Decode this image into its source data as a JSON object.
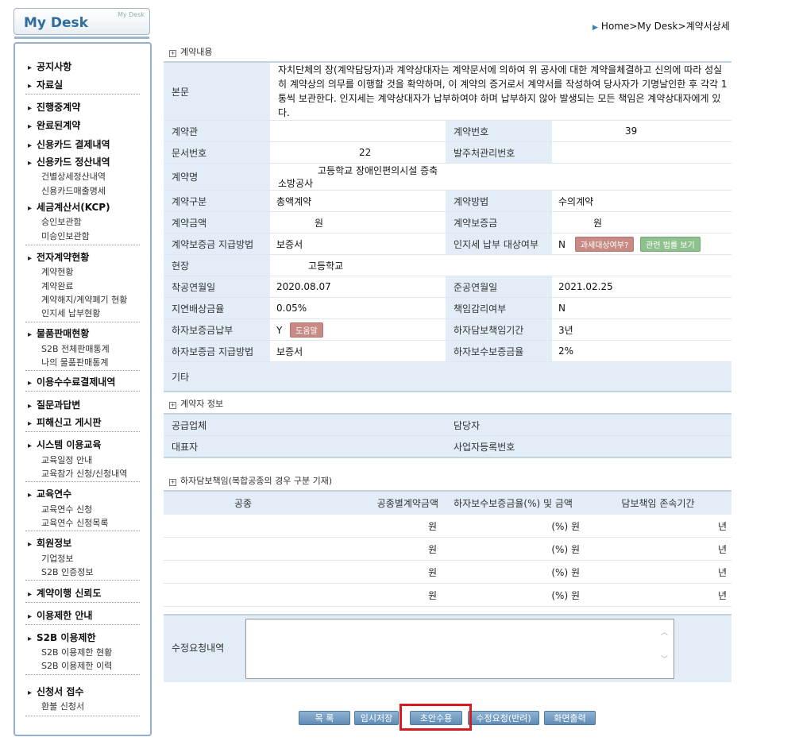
{
  "header": {
    "mydesk_title": "My Desk",
    "mydesk_small": "My Desk",
    "breadcrumb": "Home>My Desk>계약서상세"
  },
  "sidebar": {
    "sections": [
      {
        "items": [
          {
            "label": "공지사항"
          },
          {
            "label": "자료실"
          }
        ]
      },
      {
        "items": [
          {
            "label": "진행중계약"
          },
          {
            "label": "완료된계약"
          },
          {
            "label": "신용카드 결제내역"
          },
          {
            "label": "신용카드 정산내역"
          }
        ],
        "subs": [
          "건별상세정산내역",
          "신용카드매출명세"
        ]
      },
      {
        "items": [
          {
            "label": "세금계산서(KCP)"
          }
        ],
        "subs": [
          "승인보관함",
          "미승인보관함"
        ]
      },
      {
        "items": [
          {
            "label": "전자계약현황"
          }
        ],
        "subs": [
          "계약현황",
          "계약완료",
          "계약해지/계약폐기 현황",
          "인지세 납부현황"
        ]
      },
      {
        "items": [
          {
            "label": "물품판매현황"
          }
        ],
        "subs": [
          "S2B 전체판매통계",
          "나의 물품판매통계"
        ]
      },
      {
        "items": [
          {
            "label": "이용수수료결제내역"
          }
        ]
      },
      {
        "items": [
          {
            "label": "질문과답변"
          },
          {
            "label": "피해신고 게시판"
          }
        ]
      },
      {
        "items": [
          {
            "label": "시스템 이용교육"
          }
        ],
        "subs": [
          "교육일정 안내",
          "교육참가 신청/신청내역"
        ]
      },
      {
        "items": [
          {
            "label": "교육연수"
          }
        ],
        "subs": [
          "교육연수 신청",
          "교육연수 신청목록"
        ]
      },
      {
        "items": [
          {
            "label": "회원정보"
          }
        ],
        "subs": [
          "기업정보",
          "S2B 인증정보"
        ]
      },
      {
        "items": [
          {
            "label": "계약이행 신뢰도"
          }
        ]
      },
      {
        "items": [
          {
            "label": "이용제한 안내"
          }
        ]
      },
      {
        "items": [
          {
            "label": "S2B 이용제한"
          }
        ],
        "subs": [
          "S2B 이용제한 현황",
          "S2B 이용제한 이력"
        ]
      },
      {
        "items": [
          {
            "label": "신청서 접수"
          }
        ],
        "subs": [
          "환불 신청서"
        ]
      }
    ]
  },
  "contract": {
    "section_title": "계약내용",
    "body_label": "본문",
    "body_text": "자치단체의 장(계약담당자)과 계약상대자는 계약문서에 의하여 위 공사에 대한 계약을체결하고 신의에 따라 성실히 계약상의 의무를 이행할 것을 확약하며, 이 계약의 증거로서 계약서를 작성하여 당사자가 기명날인한 후 각각 1통씩 보관한다. 인지세는 계약상대자가 납부하여야 하며 납부하지 않아 발생되는 모든 책임은 계약상대자에게 있다.",
    "rows": [
      {
        "l1": "계약관",
        "v1": "",
        "l2": "계약번호",
        "v2": "39"
      },
      {
        "l1": "문서번호",
        "v1": "22",
        "l2": "발주처관리번호",
        "v2": ""
      },
      {
        "l1": "계약명",
        "v1": "고등학교 장애인편의시설 증축 소방공사",
        "l2": "",
        "v2": ""
      },
      {
        "l1": "계약구분",
        "v1": "총액계약",
        "l2": "계약방법",
        "v2": "수의계약"
      },
      {
        "l1": "계약금액",
        "v1": "원",
        "l2": "계약보증금",
        "v2": "원"
      },
      {
        "l1": "계약보증금 지급방법",
        "v1": "보증서",
        "l2": "인지세 납부 대상여부",
        "v2": "N"
      },
      {
        "l1": "현장",
        "v1": "고등학교",
        "l2": "",
        "v2": ""
      },
      {
        "l1": "착공연월일",
        "v1": "2020.08.07",
        "l2": "준공연월일",
        "v2": "2021.02.25"
      },
      {
        "l1": "지연배상금율",
        "v1": "0.05%",
        "l2": "책임감리여부",
        "v2": "N"
      },
      {
        "l1": "하자보증금납부",
        "v1": "Y",
        "l2": "하자담보책임기간",
        "v2": "3년"
      },
      {
        "l1": "하자보증금 지급방법",
        "v1": "보증서",
        "l2": "하자보수보증금율",
        "v2": "2%"
      }
    ],
    "etc_label": "기타",
    "tax_button": "과세대상여부?",
    "law_button": "관련 법률 보기",
    "help_button": "도움말"
  },
  "contractor": {
    "section_title": "계약자 정보",
    "rows": [
      {
        "l1": "공급업체",
        "l2": "담당자"
      },
      {
        "l1": "대표자",
        "l2": "사업자등록번호"
      }
    ]
  },
  "warranty": {
    "section_title": "하자담보책임(복합공종의 경우 구분 기재)",
    "headers": [
      "공종",
      "공종별계약금액",
      "하자보수보증금율(%) 및 금액",
      "담보책임 존속기간"
    ],
    "rows": [
      {
        "amount": "원",
        "rate": "(%) 원",
        "period": "년"
      },
      {
        "amount": "원",
        "rate": "(%) 원",
        "period": "년"
      },
      {
        "amount": "원",
        "rate": "(%) 원",
        "period": "년"
      },
      {
        "amount": "원",
        "rate": "(%) 원",
        "period": "년"
      }
    ]
  },
  "request": {
    "label": "수정요청내역",
    "value": ""
  },
  "buttons": {
    "list": "목 록",
    "temp_save": "임시저장",
    "accept": "초안수용",
    "reject": "수정요청(반려)",
    "print": "화면출력"
  },
  "colors": {
    "label_bg": "#e3edf7",
    "button_blue": "#5f8cb5",
    "highlight_red": "#d71920"
  }
}
